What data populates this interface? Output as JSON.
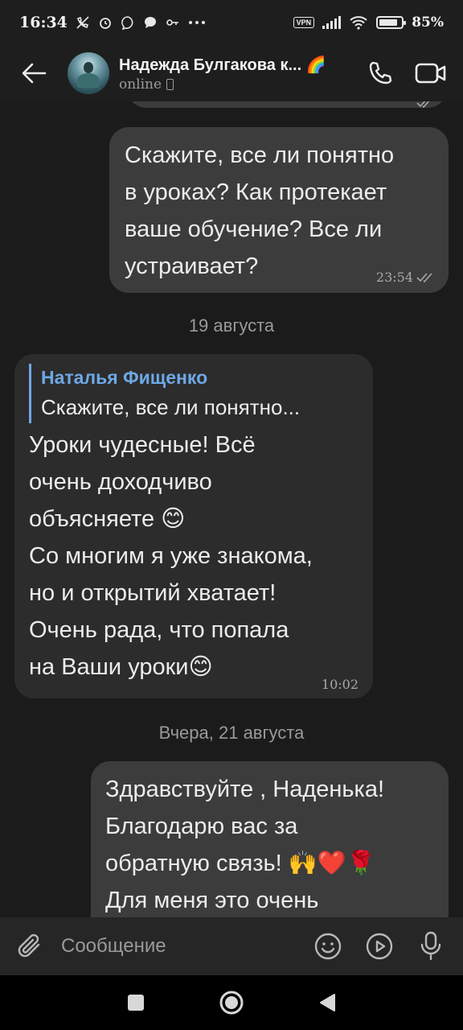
{
  "status_bar": {
    "time": "16:34",
    "icons": [
      "no-call-icon",
      "alarm-icon",
      "viber-icon",
      "chat-icon",
      "key-icon",
      "more-dots-icon"
    ],
    "vpn_label": "VPN",
    "battery_percent": "85%",
    "battery_level": 0.85
  },
  "header": {
    "title": "Надежда Булгакова к...",
    "title_emoji": "🌈",
    "status": "online"
  },
  "messages": [
    {
      "type": "out",
      "text": "Скажите, все ли понятно\nв уроках? Как протекает\nваше обучение? Все ли\nустраивает?",
      "time": "23:54"
    },
    {
      "type": "date",
      "text": "19 августа"
    },
    {
      "type": "in",
      "reply_name": "Наталья Фищенко",
      "reply_text": "Скажите, все ли понятно...",
      "text": "Уроки чудесные! Всё\nочень доходчиво\nобъясняете 😊\nСо многим я уже знакома,\nно и открытий хватает!\nОчень рада, что попала\nна Ваши уроки😊",
      "time": "10:02"
    },
    {
      "type": "date",
      "text": "Вчера, 21 августа"
    },
    {
      "type": "out",
      "text": "Здравствуйте , Наденька!\nБлагодарю вас за\nобратную связь! 🙌❤️🌹\nДля меня это очень"
    }
  ],
  "composer": {
    "placeholder": "Сообщение"
  },
  "colors": {
    "background": "#1b1b1b",
    "bubble_out": "#3c3c3c",
    "bubble_in": "#2c2c2c",
    "reply_accent": "#6ea8e6"
  }
}
